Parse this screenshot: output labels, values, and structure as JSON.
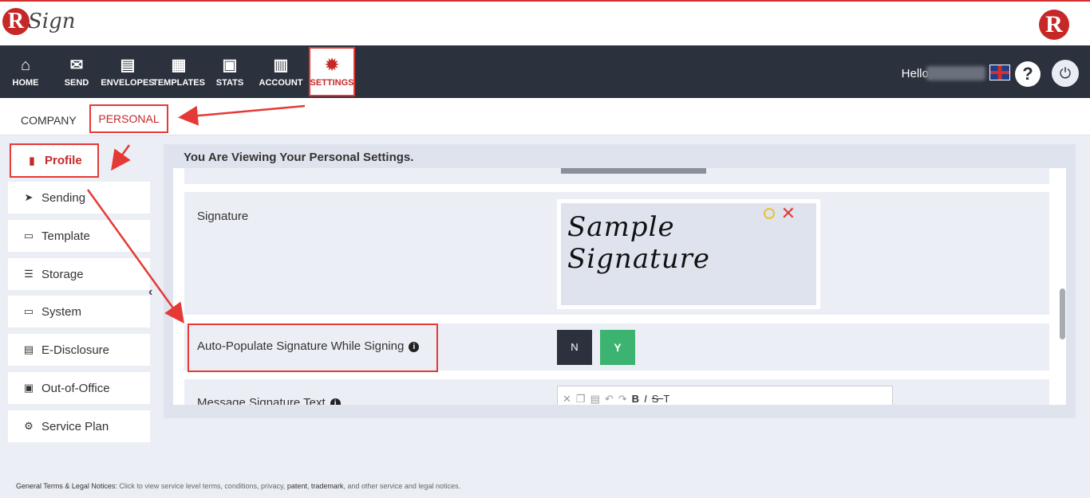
{
  "brand": {
    "logo_letter": "R",
    "logo_text": "Sign",
    "right_logo_letter": "R"
  },
  "nav": {
    "items": [
      {
        "label": "HOME",
        "icon": "home-icon"
      },
      {
        "label": "SEND",
        "icon": "envelope-icon"
      },
      {
        "label": "ENVELOPES",
        "icon": "inbox-icon"
      },
      {
        "label": "TEMPLATES",
        "icon": "templates-icon"
      },
      {
        "label": "STATS",
        "icon": "briefcase-icon"
      },
      {
        "label": "ACCOUNT",
        "icon": "account-icon"
      },
      {
        "label": "SETTINGS",
        "icon": "gear-icon"
      }
    ],
    "hello": "Hello,",
    "help": "?",
    "power": "⏻"
  },
  "tabs": {
    "company": "COMPANY",
    "personal": "PERSONAL"
  },
  "sidebar": {
    "items": [
      {
        "label": "Profile",
        "icon": "profile-icon"
      },
      {
        "label": "Sending",
        "icon": "paper-plane-icon"
      },
      {
        "label": "Template",
        "icon": "window-icon"
      },
      {
        "label": "Storage",
        "icon": "storage-icon"
      },
      {
        "label": "System",
        "icon": "monitor-icon"
      },
      {
        "label": "E-Disclosure",
        "icon": "document-icon"
      },
      {
        "label": "Out-of-Office",
        "icon": "calendar-icon"
      },
      {
        "label": "Service Plan",
        "icon": "cogs-icon"
      }
    ]
  },
  "panel": {
    "title": "You Are Viewing Your Personal Settings.",
    "signature_label": "Signature",
    "signature_sample": "Sample Signature",
    "autopopulate_label": "Auto-Populate Signature While Signing",
    "toggle_n": "N",
    "toggle_y": "Y",
    "message_signature_label": "Message Signature Text"
  },
  "footer": {
    "lead": "General Terms & Legal Notices:",
    "text": " Click to view service level terms, conditions, privacy, ",
    "patent": "patent",
    "sep": ", ",
    "trademark": "trademark",
    "tail": ", and other service and legal notices."
  }
}
